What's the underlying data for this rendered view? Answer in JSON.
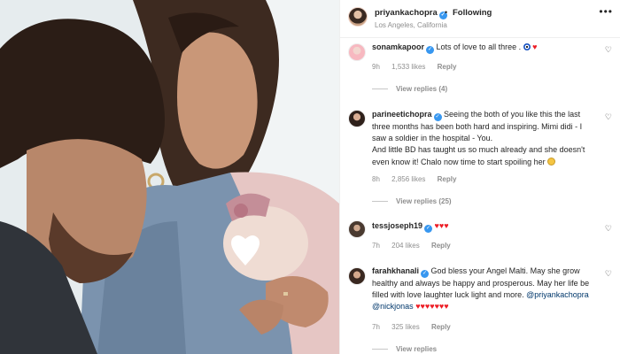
{
  "post": {
    "username": "priyankachopra",
    "follow_label": "Following",
    "dot": "•",
    "location": "Los Angeles, California",
    "more_label": "•••"
  },
  "colors": {
    "verified": "#3797f0",
    "heart": "#ed1c24",
    "link": "#00376b",
    "muted": "#8e8e8e"
  },
  "comments": [
    {
      "username": "sonamkapoor",
      "text": "Lots of love to all three .",
      "time": "9h",
      "likes": "1,533 likes",
      "reply_label": "Reply",
      "view_replies": "View replies (4)"
    },
    {
      "username": "parineetichopra",
      "text": "Seeing the both of you like this the last three months has been both hard and inspiring. Mimi didi - I saw a soldier in the hospital - You.",
      "text2": "And little BD has taught us so much already and she doesn't even know it! Chalo now time to start spoiling her",
      "time": "8h",
      "likes": "2,856 likes",
      "reply_label": "Reply",
      "view_replies": "View replies (25)"
    },
    {
      "username": "tessjoseph19",
      "text": "♥♥♥",
      "time": "7h",
      "likes": "204 likes",
      "reply_label": "Reply"
    },
    {
      "username": "farahkhanali",
      "text": "God bless your Angel Malti. May she grow healthy and always be happy and prosperous. May her life be filled with love laughter luck light and more.",
      "mention1": "@priyankachopra",
      "mention2": "@nickjonas",
      "hearts": "♥♥♥♥♥♥♥",
      "time": "7h",
      "likes": "325 likes",
      "reply_label": "Reply",
      "view_replies": "View replies"
    }
  ],
  "icons": {
    "like": "heart-outline-icon",
    "verified": "verified-badge-icon",
    "more": "more-options-icon"
  }
}
